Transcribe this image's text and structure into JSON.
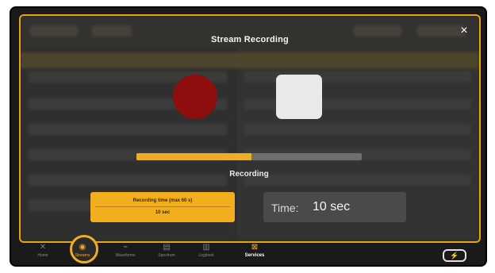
{
  "modal": {
    "title": "Stream Recording",
    "close_icon": "×",
    "progress_fraction": 0.51,
    "status": "Recording",
    "recording_time_button": {
      "line1": "Recording time (max 60 s)",
      "line2": "10 sec"
    },
    "time_label": "Time:",
    "time_value": "10 sec"
  },
  "tabbar": {
    "tabs": [
      {
        "icon": "✕",
        "label": "Home",
        "state": "normal"
      },
      {
        "icon": "◉",
        "label": "Streams",
        "state": "active"
      },
      {
        "icon": "⌁",
        "label": "Waveforms",
        "state": "normal"
      },
      {
        "icon": "▤",
        "label": "Spectrum",
        "state": "normal"
      },
      {
        "icon": "▥",
        "label": "Logbook",
        "state": "normal"
      },
      {
        "icon": "⊠",
        "label": "Services",
        "state": "highlight"
      }
    ],
    "battery_icon": "⚡"
  },
  "colors": {
    "accent": "#f1ad22",
    "record": "#8e0d0d",
    "stop": "#e9e9e9"
  }
}
